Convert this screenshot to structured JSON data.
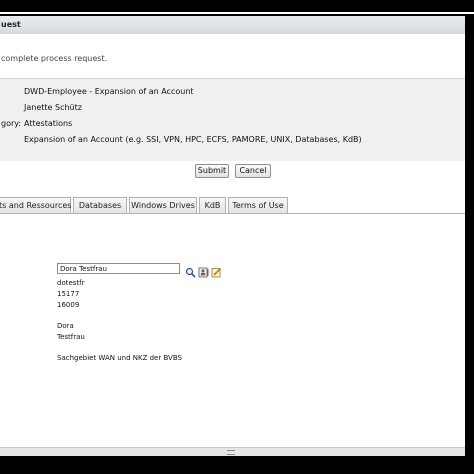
{
  "header": {
    "title": "uest"
  },
  "info": {
    "text": "complete process request."
  },
  "form": {
    "rows": [
      {
        "label": "",
        "value": "DWD-Employee - Expansion of an Account"
      },
      {
        "label": "",
        "value": "Janette Schütz"
      },
      {
        "label": "gory:",
        "value": "Attestations"
      },
      {
        "label": "",
        "value": "Expansion of an Account (e.g. SSI, VPN, HPC, ECFS, PAMORE, UNIX, Databases, KdB)"
      }
    ]
  },
  "buttons": {
    "submit": "Submit",
    "cancel": "Cancel"
  },
  "tabs": [
    {
      "label": "ts and Ressources"
    },
    {
      "label": "Databases"
    },
    {
      "label": "Windows Drives"
    },
    {
      "label": "KdB"
    },
    {
      "label": "Terms of Use"
    }
  ],
  "person": {
    "search_value": "Dora Testfrau",
    "user_id": "dotestfr",
    "number1": "15177",
    "number2": "16009",
    "first_name": "Dora",
    "last_name": "Testfrau",
    "department": "Sachgebiet WAN und NKZ der BVBS"
  },
  "icons": {
    "search": "search-icon",
    "address_book": "address-book-icon",
    "edit": "edit-icon"
  }
}
